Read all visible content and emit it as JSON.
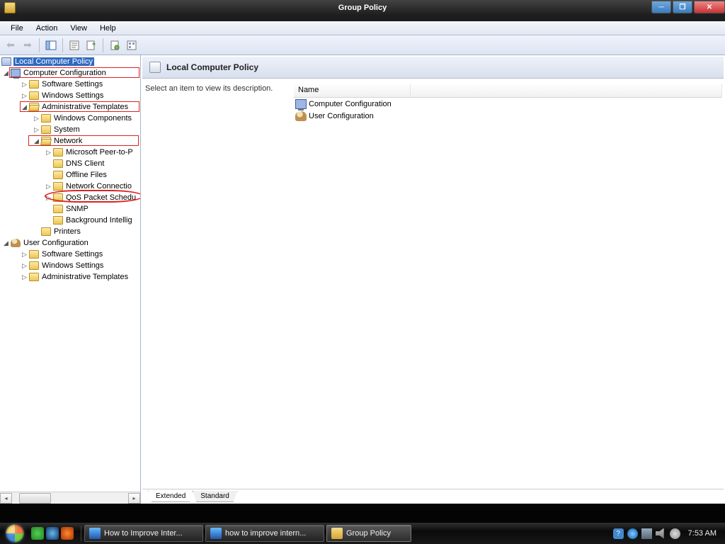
{
  "window": {
    "title": "Group Policy"
  },
  "menus": {
    "file": "File",
    "action": "Action",
    "view": "View",
    "help": "Help"
  },
  "tree": {
    "root": "Local Computer Policy",
    "compConfig": "Computer Configuration",
    "compChildren": {
      "software": "Software Settings",
      "windows": "Windows Settings",
      "admin": "Administrative Templates",
      "adminChildren": {
        "winComp": "Windows Components",
        "system": "System",
        "network": "Network",
        "networkChildren": {
          "p2p": "Microsoft Peer-to-P",
          "dns": "DNS Client",
          "offline": "Offline Files",
          "netconn": "Network Connectio",
          "qos": "QoS Packet Schedu",
          "snmp": "SNMP",
          "bits": "Background Intellig"
        },
        "printers": "Printers"
      }
    },
    "userConfig": "User Configuration",
    "userChildren": {
      "software": "Software Settings",
      "windows": "Windows Settings",
      "admin": "Administrative Templates"
    }
  },
  "rightPanel": {
    "title": "Local Computer Policy",
    "description": "Select an item to view its description.",
    "columnName": "Name",
    "items": {
      "comp": "Computer Configuration",
      "user": "User Configuration"
    },
    "tabs": {
      "extended": "Extended",
      "standard": "Standard"
    }
  },
  "taskbar": {
    "btn1": "How to Improve Inter...",
    "btn2": "how to improve intern...",
    "btn3": "Group Policy",
    "clock": "7:53 AM"
  }
}
